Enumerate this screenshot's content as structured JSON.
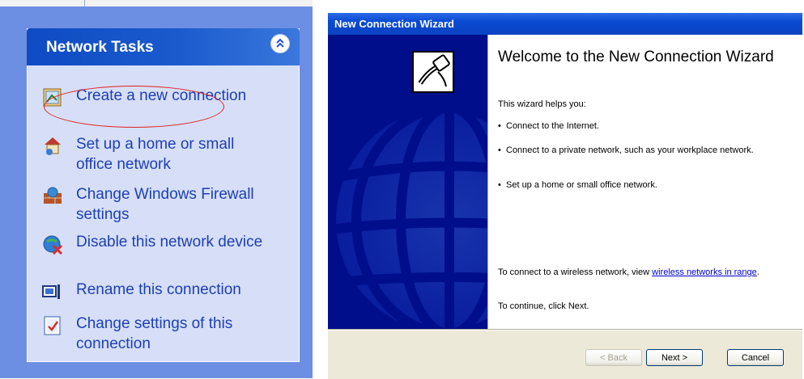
{
  "network_tasks": {
    "title": "Network Tasks",
    "collapse_glyph": "⌃",
    "items": [
      {
        "label": "Create a new connection",
        "icon": "new-connection-icon"
      },
      {
        "label": "Set up a home or small office network",
        "icon": "home-network-icon"
      },
      {
        "label": "Change Windows Firewall settings",
        "icon": "firewall-icon"
      },
      {
        "label": "Disable this network device",
        "icon": "disable-device-icon"
      },
      {
        "label": "Rename this connection",
        "icon": "rename-icon"
      },
      {
        "label": "Change settings of this connection",
        "icon": "settings-icon"
      }
    ],
    "highlight_color": "#e02020"
  },
  "wizard": {
    "title": "New Connection Wizard",
    "welcome_title": "Welcome to the New Connection Wizard",
    "intro": "This wizard helps you:",
    "bullets": [
      "Connect to the Internet.",
      "Connect to a private network, such as your workplace network.",
      "Set up a home or small office network."
    ],
    "wireless_prefix": "To connect to a wireless network, view",
    "wireless_link": "wireless networks in range",
    "wireless_suffix": ".",
    "continue_text": "To continue, click Next.",
    "buttons": {
      "back": "< Back",
      "next": "Next >",
      "cancel": "Cancel"
    },
    "colors": {
      "titlebar": "#0a4ad2",
      "sidebar": "#000e8c",
      "dialog": "#ece9d8"
    }
  }
}
